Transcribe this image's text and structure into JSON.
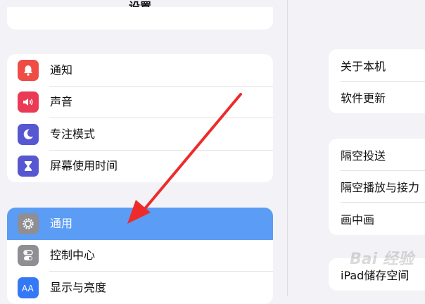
{
  "sidebar": {
    "title": "设置",
    "group1": [
      {
        "label": "通知",
        "icon": "bell-icon",
        "color": "#ef4c46"
      },
      {
        "label": "声音",
        "icon": "speaker-icon",
        "color": "#ea3a55"
      },
      {
        "label": "专注模式",
        "icon": "moon-icon",
        "color": "#5757d2"
      },
      {
        "label": "屏幕使用时间",
        "icon": "hourglass-icon",
        "color": "#5757d2"
      }
    ],
    "group2": [
      {
        "label": "通用",
        "icon": "gear-icon",
        "color": "#8e8e93",
        "selected": true
      },
      {
        "label": "控制中心",
        "icon": "toggle-switches-icon",
        "color": "#8e8e93"
      },
      {
        "label": "显示与亮度",
        "icon": "text-size-icon",
        "color": "#3478f6"
      }
    ]
  },
  "detail": {
    "group1": [
      "关于本机",
      "软件更新"
    ],
    "group2": [
      "隔空投送",
      "隔空播放与接力",
      "画中画"
    ],
    "group3": [
      "iPad储存空间"
    ]
  },
  "annotation": {
    "arrow_color": "#ee2b2b"
  },
  "watermark": "Bai 经验"
}
